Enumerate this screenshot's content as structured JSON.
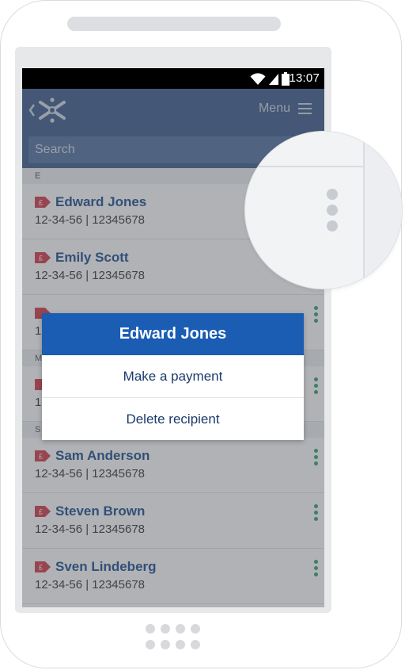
{
  "status_bar": {
    "time": "13:07",
    "icons": [
      "wifi-icon",
      "signal-icon",
      "battery-icon"
    ]
  },
  "app_bar": {
    "logo_icon": "back-logo-icon",
    "menu_label": "Menu",
    "menu_icon": "hamburger-icon"
  },
  "search": {
    "placeholder": "Search"
  },
  "sections": [
    {
      "letter": "E",
      "items": [
        {
          "name": "Edward Jones",
          "account": "12-34-56 | 12345678"
        },
        {
          "name": "Emily Scott",
          "account": "12-34-56 | 12345678"
        },
        {
          "name": "",
          "account": "12"
        }
      ]
    },
    {
      "letter": "M",
      "items": [
        {
          "name": "",
          "account": "1"
        }
      ]
    },
    {
      "letter": "S",
      "items": [
        {
          "name": "Sam Anderson",
          "account": "12-34-56 | 12345678"
        },
        {
          "name": "Steven Brown",
          "account": "12-34-56 | 12345678"
        },
        {
          "name": "Sven Lindeberg",
          "account": "12-34-56 | 12345678"
        }
      ]
    }
  ],
  "dialog": {
    "title": "Edward Jones",
    "options": [
      "Make a payment",
      "Delete recipient"
    ]
  },
  "colors": {
    "app_bar": "#3c5a8c",
    "dialog_header": "#1a5db3",
    "name_text": "#1b4b8f",
    "more_dots": "#2fa36b",
    "tag": "#d43a4a"
  }
}
